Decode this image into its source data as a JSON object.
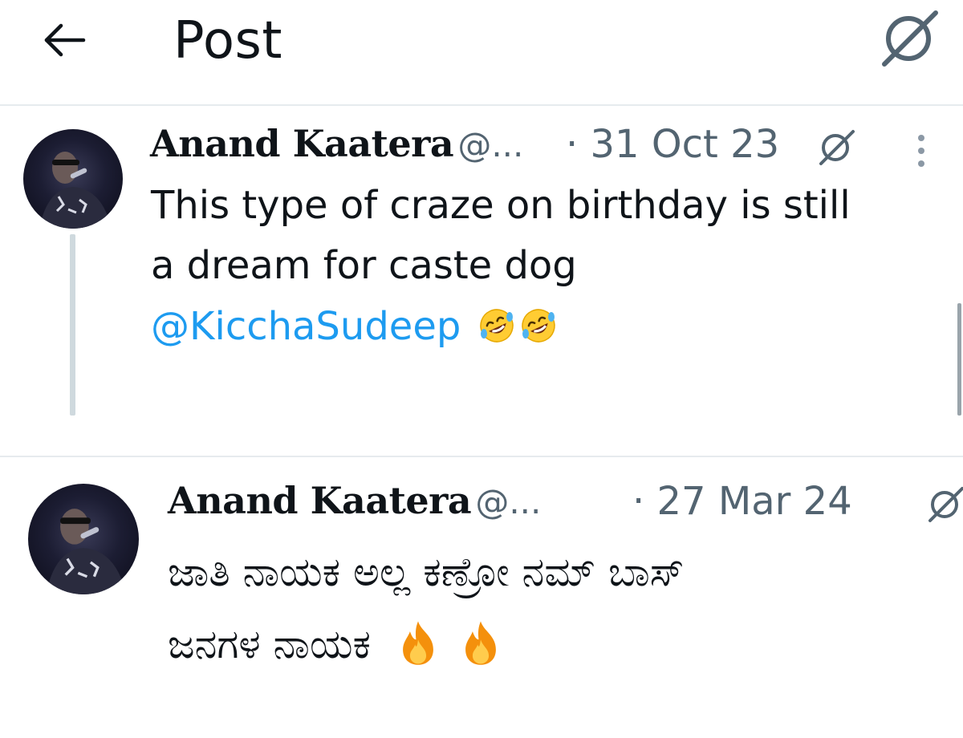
{
  "header": {
    "title": "Post"
  },
  "icons": {
    "back": "arrow-left-icon",
    "grok": "grok-slash-icon",
    "more": "more-vertical-icon",
    "laugh": "rolling-laughing-emoji",
    "fire": "fire-emoji"
  },
  "colors": {
    "text": "#0f1419",
    "secondary": "#536471",
    "link": "#1d9bf0",
    "divider": "#e6ebee"
  },
  "tweets": [
    {
      "name": "Anand Kaatera",
      "handle": "@...",
      "date": "· 31 Oct 23",
      "text_line1": "This type of craze on birthday is still",
      "text_line2": "a dream for caste dog",
      "mention": "@KicchaSudeep"
    },
    {
      "name": "Anand Kaatera",
      "handle": "@...",
      "date": "· 27 Mar 24",
      "text_line1": "ಜಾತಿ ನಾಯಕ ಅಲ್ಲ ಕಣ್ರೋ ನಮ್ ಬಾಸ್",
      "text_line2": "ಜನಗಳ ನಾಯಕ"
    }
  ]
}
